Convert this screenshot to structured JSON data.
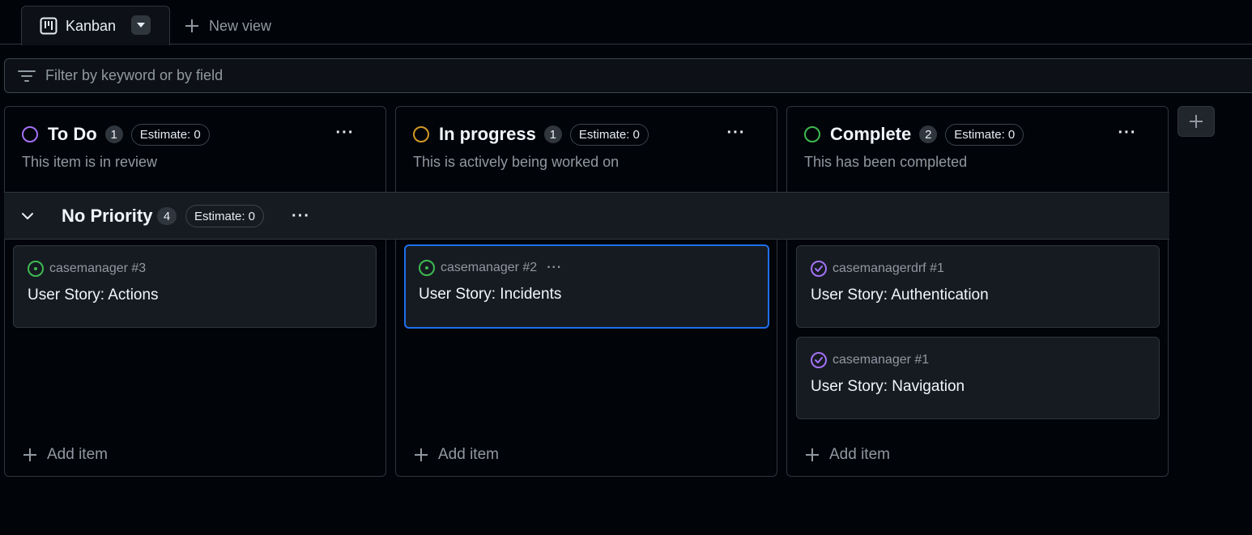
{
  "tabs": {
    "active": {
      "label": "Kanban",
      "icon": "kanban-icon"
    },
    "new_view_label": "New view"
  },
  "filter": {
    "placeholder": "Filter by keyword or by field"
  },
  "columns": [
    {
      "name": "To Do",
      "count": "1",
      "estimate": "Estimate: 0",
      "description": "This item is in review",
      "status_color": "#a371f7"
    },
    {
      "name": "In progress",
      "count": "1",
      "estimate": "Estimate: 0",
      "description": "This is actively being worked on",
      "status_color": "#d29922"
    },
    {
      "name": "Complete",
      "count": "2",
      "estimate": "Estimate: 0",
      "description": "This has been completed",
      "status_color": "#3fb950"
    }
  ],
  "group": {
    "name": "No Priority",
    "count": "4",
    "estimate": "Estimate: 0"
  },
  "cards": {
    "todo": [
      {
        "repo": "casemanager #3",
        "title": "User Story: Actions",
        "status": "open"
      }
    ],
    "inprogress": [
      {
        "repo": "casemanager #2",
        "title": "User Story: Incidents",
        "status": "open"
      }
    ],
    "complete": [
      {
        "repo": "casemanagerdrf #1",
        "title": "User Story: Authentication",
        "status": "closed"
      },
      {
        "repo": "casemanager #1",
        "title": "User Story: Navigation",
        "status": "closed"
      }
    ]
  },
  "add_item_label": "Add item",
  "colors": {
    "accent": "#1f6feb",
    "open": "#3fb950",
    "closed": "#a371f7"
  }
}
